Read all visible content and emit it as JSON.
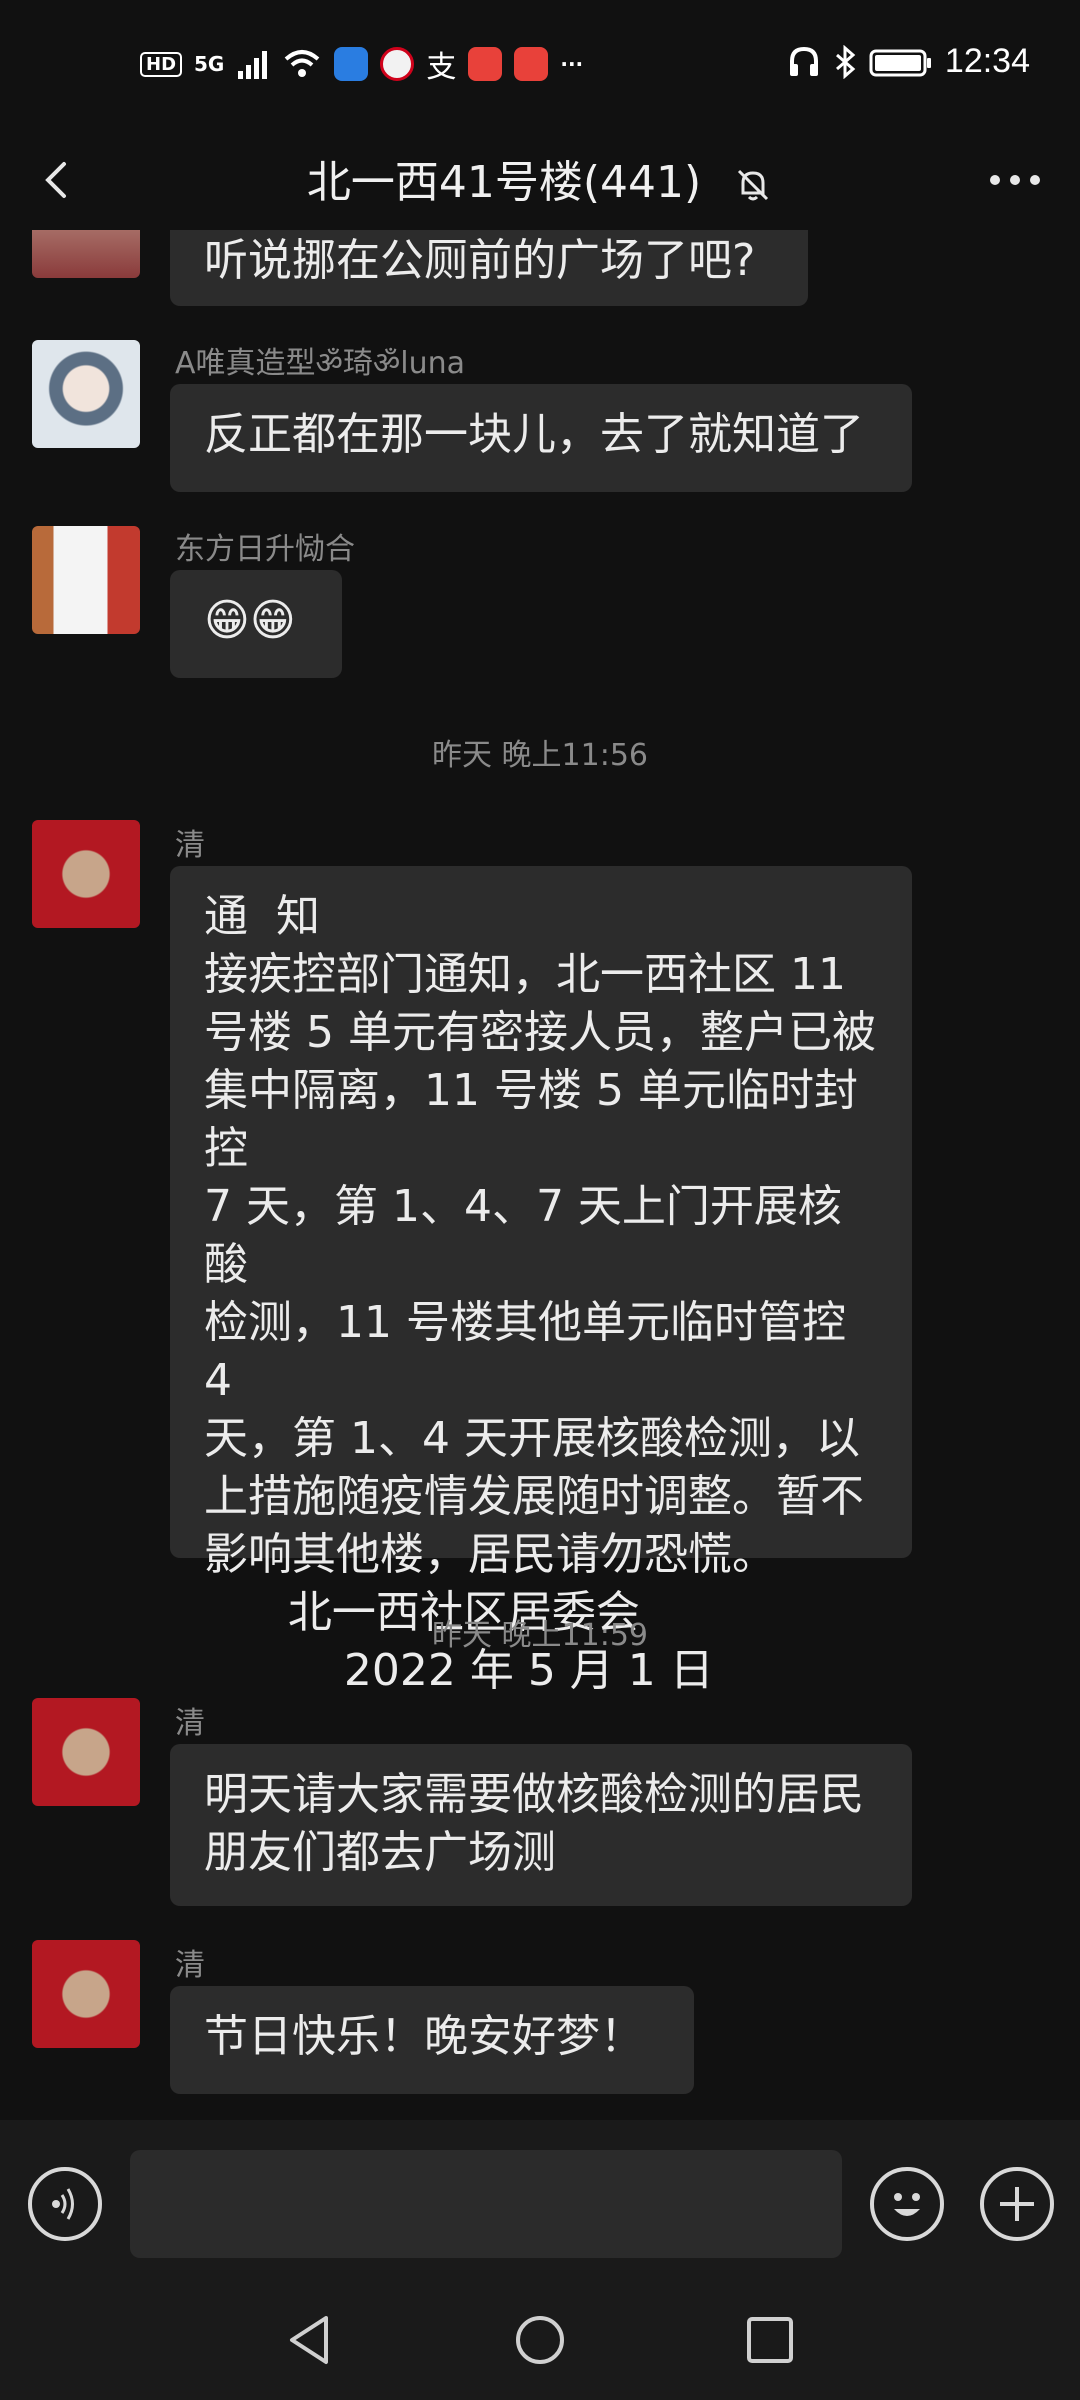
{
  "status_bar": {
    "hd": "HD",
    "network": "5G",
    "more": "···",
    "time": "12:34"
  },
  "header": {
    "title": "北一西41号楼(441)"
  },
  "messages": [
    {
      "text": "听说挪在公厕前的广场了吧?"
    },
    {
      "sender": "A唯真造型ॐ琦ॐluna",
      "text": "反正都在那一块儿，去了就知道了"
    },
    {
      "sender": "东方日升恸合",
      "text": "😁😁"
    },
    {
      "timestamp": "昨天 晚上11:56"
    },
    {
      "sender": "清",
      "text": "通  知\n接疾控部门通知，北一西社区 11\n号楼 5 单元有密接人员，整户已被\n集中隔离，11 号楼 5 单元临时封控\n7 天，第 1、4、7 天上门开展核酸\n检测，11 号楼其他单元临时管控 4\n天，第 1、4 天开展核酸检测，以\n上措施随疫情发展随时调整。暂不\n影响其他楼，居民请勿恐慌。\n      北一西社区居委会\n          2022 年 5 月 1 日"
    },
    {
      "timestamp": "昨天 晚上11:59"
    },
    {
      "sender": "清",
      "text": "明天请大家需要做核酸检测的居民\n朋友们都去广场测"
    },
    {
      "sender": "清",
      "text": "节日快乐！晚安好梦！"
    }
  ],
  "input": {
    "value": ""
  },
  "colors": {
    "background": "#111111",
    "bubble": "#2c2c2c",
    "muted_text": "#8a8a8a"
  },
  "icons": [
    "back-arrow-icon",
    "mute-bell-icon",
    "more-dots-icon",
    "voice-icon",
    "emoji-icon",
    "plus-icon",
    "nav-back-icon",
    "nav-home-icon",
    "nav-recents-icon"
  ]
}
